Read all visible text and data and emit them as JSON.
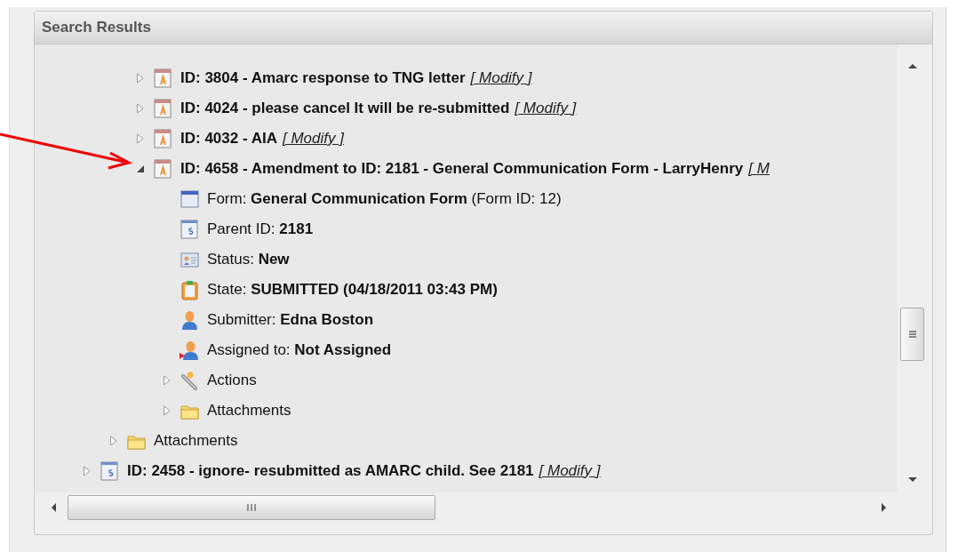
{
  "panel": {
    "title": "Search Results"
  },
  "tree": [
    {
      "children": [
        {
          "children": [
            {
              "kind": "record",
              "label": "ID: 3804 - Amarc response to TNG letter",
              "link": "[ Modify ]",
              "expanded": false
            },
            {
              "kind": "record",
              "label": "ID: 4024 - please cancel It will be re-submitted",
              "link": "[ Modify ]",
              "expanded": false
            },
            {
              "kind": "record",
              "label": "ID: 4032 - AIA",
              "link": "[ Modify ]",
              "expanded": false
            },
            {
              "kind": "record",
              "label": "ID: 4658 - Amendment to ID: 2181 - General Communication Form - LarryHenry",
              "link": "[ M",
              "expanded": true,
              "children": [
                {
                  "kind": "form",
                  "label": "Form: **General Communication Form** (Form ID: 12)"
                },
                {
                  "kind": "parent",
                  "label": "Parent ID: **2181**"
                },
                {
                  "kind": "status",
                  "label": "Status: **New**"
                },
                {
                  "kind": "state",
                  "label": "State: **SUBMITTED (04/18/2011 03:43 PM)**"
                },
                {
                  "kind": "submitter",
                  "label": "Submitter: **Edna Boston**"
                },
                {
                  "kind": "assignee",
                  "label": "Assigned to: **Not Assigned**"
                },
                {
                  "kind": "actions",
                  "label": "Actions",
                  "expanded": false
                },
                {
                  "kind": "folder",
                  "label": "Attachments",
                  "expanded": false
                }
              ]
            }
          ]
        },
        {
          "kind": "folder",
          "label": "Attachments",
          "expanded": false
        }
      ]
    },
    {
      "kind": "parent-record",
      "label": "ID: 2458 - ignore- resubmitted as AMARC child. See 2181",
      "link": "[ Modify ]",
      "expanded": false
    }
  ]
}
